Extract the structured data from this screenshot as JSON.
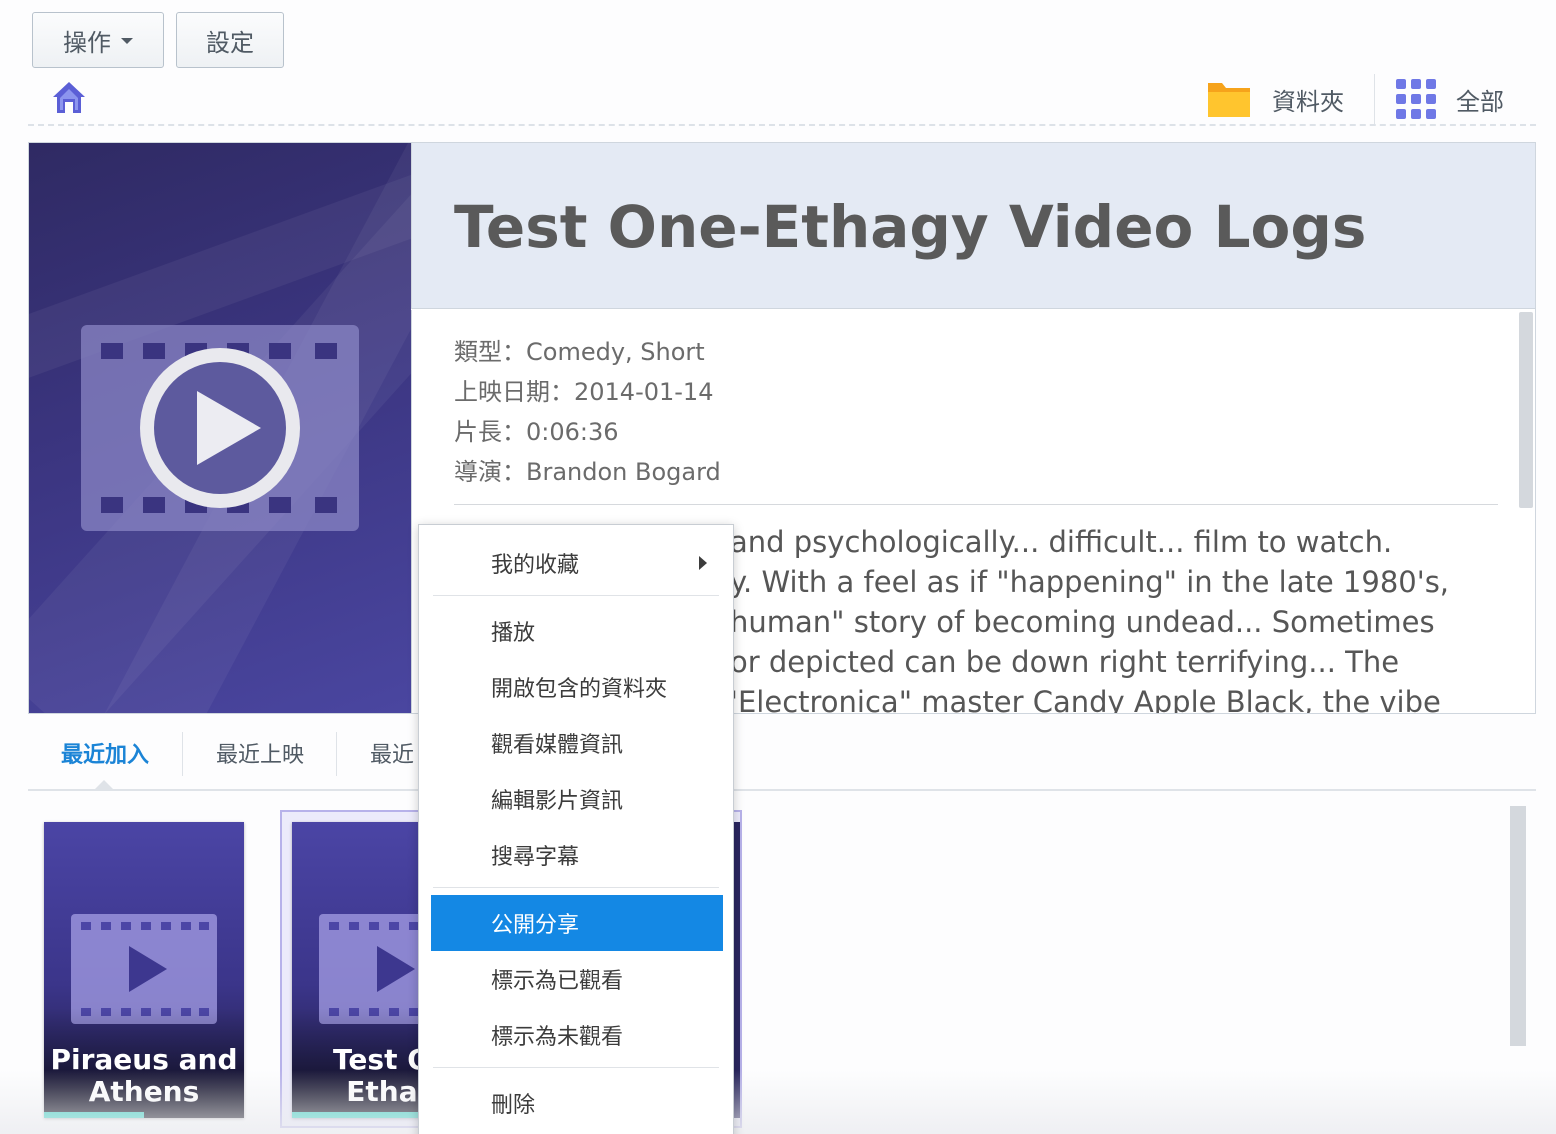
{
  "toolbar": {
    "action_label": "操作",
    "settings_label": "設定"
  },
  "view_switch": {
    "folder_label": "資料夾",
    "all_label": "全部"
  },
  "detail": {
    "title": "Test One-Ethagy Video Logs",
    "meta": [
      "類型：Comedy, Short",
      "上映日期：2014-01-14",
      "片長：0:06:36",
      "導演：Brandon Bogard"
    ],
    "description_lines": [
      "and psychologically... difficult... film to watch.",
      "y. With a feel as if \"happening\" in the late 1980's,",
      "human\" story of becoming undead... Sometimes",
      "or depicted can be down right terrifying... The",
      "'Electronica\" master Candy Apple Black, the vibe"
    ]
  },
  "tabs": [
    "最近加入",
    "最近上映",
    "最近"
  ],
  "cards": [
    {
      "title_lines": [
        "Piraeus and",
        "Athens"
      ],
      "progress": 0.5
    },
    {
      "title_lines": [
        "Test On",
        "Ethag"
      ],
      "progress": 0.65
    }
  ],
  "context_menu": {
    "items": [
      {
        "label": "我的收藏",
        "has_submenu": true
      },
      {
        "label": "播放"
      },
      {
        "label": "開啟包含的資料夾"
      },
      {
        "label": "觀看媒體資訊"
      },
      {
        "label": "編輯影片資訊"
      },
      {
        "label": "搜尋字幕"
      },
      {
        "label": "公開分享",
        "highlighted": true
      },
      {
        "label": "標示為已觀看"
      },
      {
        "label": "標示為未觀看"
      },
      {
        "label": "刪除"
      }
    ]
  },
  "colors": {
    "accent": "#1488e4",
    "poster_dark": "#2f2a63",
    "progress": "#3ed3c3"
  }
}
